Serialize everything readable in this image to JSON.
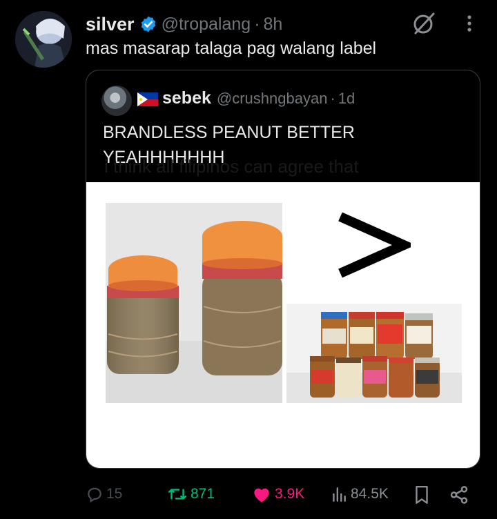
{
  "post": {
    "author_name": "silver",
    "handle": "@tropalang",
    "separator": "·",
    "time": "8h",
    "text": "mas masarap talaga pag walang label"
  },
  "quote": {
    "author_name": "sebek",
    "handle": "@crushngbayan",
    "separator": "·",
    "time": "1d",
    "text": "BRANDLESS PEANUT BETTER YEAHHHHHHH",
    "media_caption": "i think all filipinos can agree that",
    "comparison_symbol": ">"
  },
  "actions": {
    "replies": "15",
    "reposts": "871",
    "likes": "3.9K",
    "views": "84.5K"
  },
  "colors": {
    "background": "#000000",
    "text_primary": "#e7e9ea",
    "text_secondary": "#71767b",
    "verified_blue": "#1d9bf0",
    "repost_green": "#00ba7c",
    "like_pink": "#f91880"
  },
  "icons": [
    "verified-badge-icon",
    "grok-icon",
    "more-icon",
    "reply-icon",
    "repost-icon",
    "like-icon",
    "views-icon",
    "bookmark-icon",
    "share-icon"
  ]
}
